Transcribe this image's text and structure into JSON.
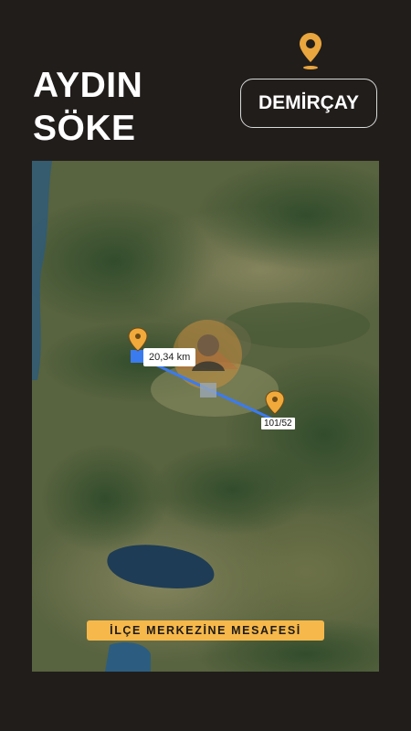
{
  "header": {
    "city": "AYDIN",
    "district": "SÖKE",
    "destination": "DEMİRÇAY",
    "pin_icon": "location-pin-icon",
    "accent_color": "#f0a93a"
  },
  "map": {
    "distance_label": "20,34 km",
    "parcel_label": "101/52",
    "route_color": "#3b7bf0",
    "marker_color": "#f0a93a",
    "watermark_icon": "profile-avatar-watermark",
    "banner": "İLÇE MERKEZİNE MESAFESİ"
  }
}
